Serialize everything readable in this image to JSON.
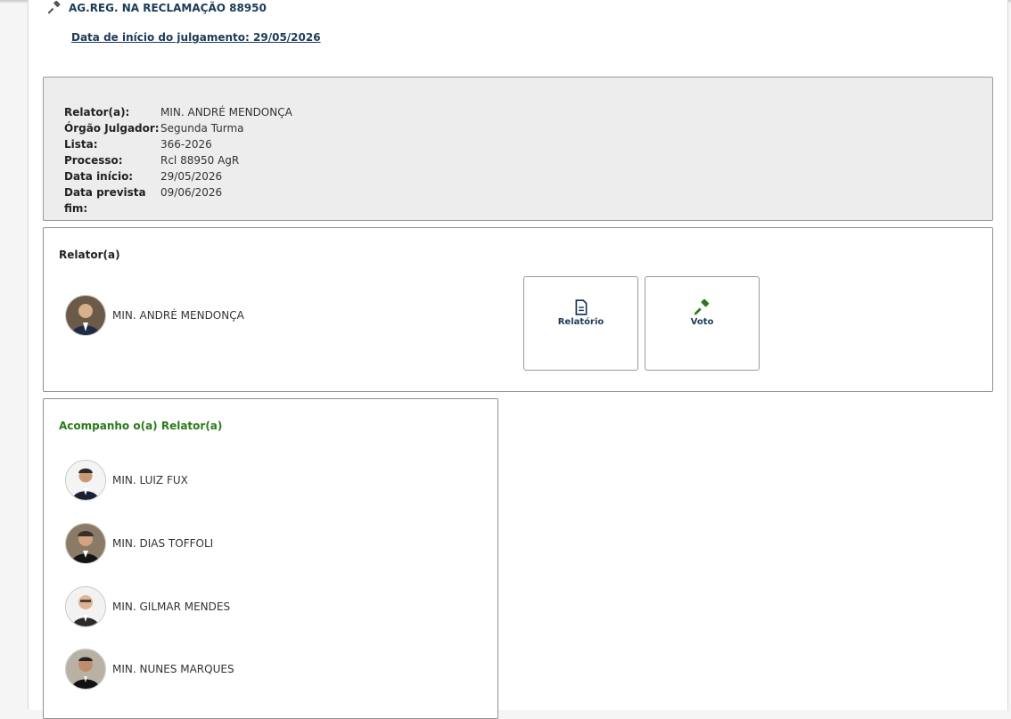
{
  "header": {
    "case_title": "AG.REG. NA RECLAMAÇÃO 88950",
    "start_link": "Data de início do julgamento: 29/05/2026"
  },
  "info": {
    "rows": [
      {
        "label": "Relator(a):",
        "value": "MIN. ANDRÉ MENDONÇA"
      },
      {
        "label": "Órgão Julgador:",
        "value": "Segunda Turma"
      },
      {
        "label": "Lista:",
        "value": "366-2026"
      },
      {
        "label": "Processo:",
        "value": "Rcl 88950 AgR"
      },
      {
        "label": "Data início:",
        "value": "29/05/2026"
      },
      {
        "label": "Data prevista fim:",
        "value": "09/06/2026"
      }
    ]
  },
  "relator_panel": {
    "heading": "Relator(a)",
    "minister_name": "MIN. ANDRÉ MENDONÇA",
    "actions": [
      {
        "label": "Relatório",
        "icon": "document-icon"
      },
      {
        "label": "Voto",
        "icon": "gavel-icon"
      }
    ]
  },
  "follow_panel": {
    "heading": "Acompanho o(a) Relator(a)",
    "ministers": [
      {
        "name": "MIN. LUIZ FUX"
      },
      {
        "name": "MIN. DIAS TOFFOLI"
      },
      {
        "name": "MIN. GILMAR MENDES"
      },
      {
        "name": "MIN. NUNES MARQUES"
      }
    ]
  },
  "colors": {
    "accent_blue": "#1c3b57",
    "accent_green": "#2a7a1c",
    "info_bg": "#ededed"
  }
}
